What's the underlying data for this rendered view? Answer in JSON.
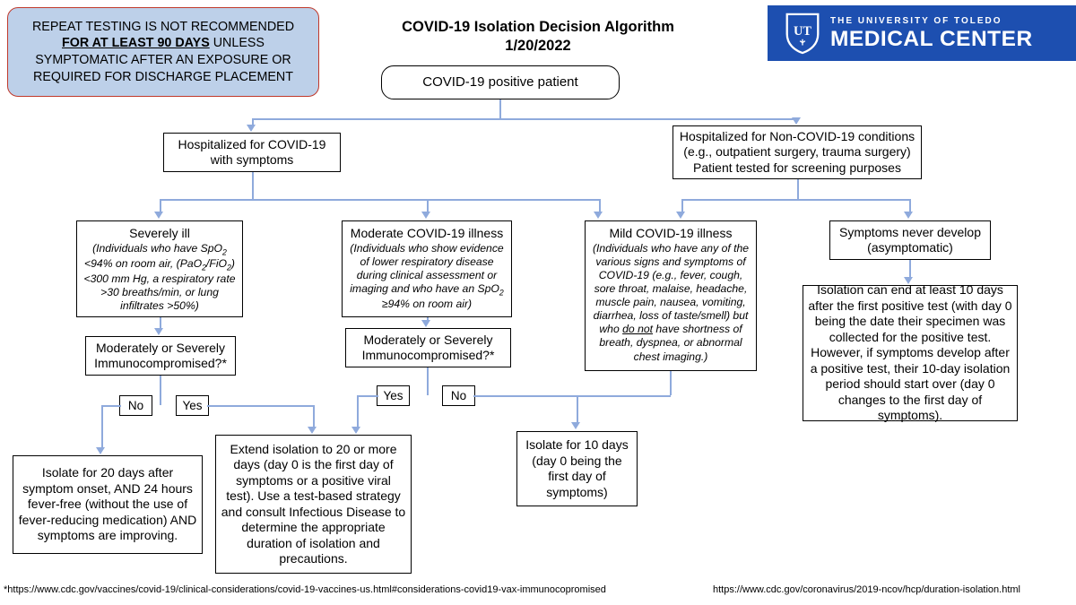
{
  "notice": {
    "line1": "REPEAT TESTING IS NOT RECOMMENDED",
    "emphasis": "FOR AT LEAST 90 DAYS",
    "line2_rest": " UNLESS",
    "line3": "SYMPTOMATIC AFTER AN EXPOSURE OR",
    "line4": "REQUIRED FOR DISCHARGE PLACEMENT"
  },
  "title": {
    "main": "COVID-19 Isolation Decision Algorithm",
    "date": "1/20/2022"
  },
  "logo": {
    "monogram": "UT",
    "line1": "THE UNIVERSITY OF TOLEDO",
    "line2": "MEDICAL CENTER",
    "brand_color": "#1d4fb0"
  },
  "nodes": {
    "start": "COVID-19 positive patient",
    "hosp_covid": "Hospitalized for COVID-19 with symptoms",
    "hosp_noncovid": "Hospitalized for Non-COVID-19 conditions (e.g., outpatient surgery, trauma surgery) Patient tested for screening purposes",
    "severe_title": "Severely ill",
    "severe_body": "(Individuals who have SpO2 <94% on room air, (PaO2/FiO2) <300 mm Hg, a respiratory rate >30 breaths/min, or lung infiltrates >50%)",
    "moderate_title": "Moderate COVID-19 illness",
    "moderate_body": "(Individuals who show evidence of lower respiratory disease during clinical assessment or imaging and who have an SpO2 ≥94% on room air)",
    "mild_title": "Mild COVID-19 illness",
    "mild_body": "(Individuals who have any of the various signs and symptoms of COVID-19 (e.g., fever, cough, sore throat, malaise, headache, muscle pain, nausea, vomiting, diarrhea, loss of taste/smell) but who do not have shortness of breath, dyspnea, or abnormal chest imaging.)",
    "asymptomatic": "Symptoms never develop (asymptomatic)",
    "immuno_left": "Moderately or Severely Immunocompromised?*",
    "immuno_mid": "Moderately or Severely Immunocompromised?*",
    "outcome_20day": "Isolate for 20 days after symptom onset, AND 24 hours fever-free (without the use of fever-reducing medication) AND symptoms are improving.",
    "outcome_extend": "Extend isolation to 20 or more days (day 0 is the first day of symptoms or a positive viral test). Use a test-based strategy and consult Infectious Disease to determine the appropriate duration of isolation and precautions.",
    "outcome_10day": "Isolate for 10 days (day 0 being the first day of symptoms)",
    "outcome_asymptomatic": "Isolation can end at least 10 days after the first positive test (with day 0 being the date their specimen was collected for the positive test. However, if symptoms develop after a positive test, their 10-day isolation period should start over (day 0 changes to the first day of symptoms)."
  },
  "edge_labels": {
    "left_no": "No",
    "left_yes": "Yes",
    "mid_yes": "Yes",
    "mid_no": "No"
  },
  "footer": {
    "left": "*https://www.cdc.gov/vaccines/covid-19/clinical-considerations/covid-19-vaccines-us.html#considerations-covid19-vax-immunocopromised",
    "right": "https://www.cdc.gov/coronavirus/2019-ncov/hcp/duration-isolation.html"
  },
  "colors": {
    "connector": "#8faadc",
    "banner_fill": "#bdd0e9",
    "banner_border": "#c0392b"
  }
}
